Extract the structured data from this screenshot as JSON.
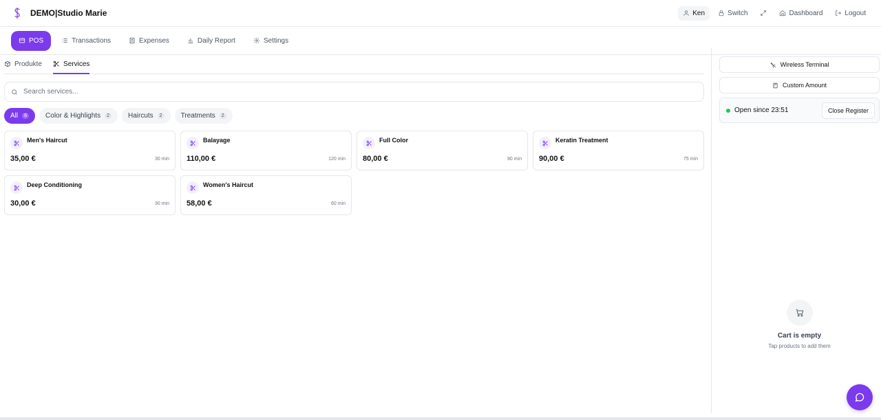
{
  "header": {
    "brand": "DEMO|Studio Marie",
    "user": "Ken",
    "switch_label": "Switch",
    "dashboard_label": "Dashboard",
    "logout_label": "Logout"
  },
  "nav": {
    "tabs": [
      {
        "label": "POS",
        "icon": "card-icon",
        "active": true
      },
      {
        "label": "Transactions",
        "icon": "list-icon"
      },
      {
        "label": "Expenses",
        "icon": "receipt-icon"
      },
      {
        "label": "Daily Report",
        "icon": "bar-chart-icon"
      },
      {
        "label": "Settings",
        "icon": "gear-icon"
      }
    ]
  },
  "subtabs": [
    {
      "label": "Produkte",
      "icon": "box-icon"
    },
    {
      "label": "Services",
      "icon": "scissors-icon",
      "active": true
    }
  ],
  "search": {
    "placeholder": "Search services..."
  },
  "categories": [
    {
      "label": "All",
      "count": "6",
      "active": true
    },
    {
      "label": "Color & Highlights",
      "count": "2"
    },
    {
      "label": "Haircuts",
      "count": "2"
    },
    {
      "label": "Treatments",
      "count": "2"
    }
  ],
  "services": [
    {
      "name": "Men's Haircut",
      "price": "35,00 €",
      "duration": "30 min"
    },
    {
      "name": "Balayage",
      "price": "110,00 €",
      "duration": "120 min"
    },
    {
      "name": "Full Color",
      "price": "80,00 €",
      "duration": "90 min"
    },
    {
      "name": "Keratin Treatment",
      "price": "90,00 €",
      "duration": "75 min"
    },
    {
      "name": "Deep Conditioning",
      "price": "30,00 €",
      "duration": "30 min"
    },
    {
      "name": "Women's Haircut",
      "price": "58,00 €",
      "duration": "60 min"
    }
  ],
  "panel": {
    "wireless_terminal_label": "Wireless Terminal",
    "custom_amount_label": "Custom Amount",
    "register_status": "Open since 23:51",
    "close_register_label": "Close Register",
    "cart_empty_title": "Cart is empty",
    "cart_empty_subtitle": "Tap products to add them"
  },
  "colors": {
    "accent": "#7c3aed",
    "status_open": "#22c55e"
  }
}
